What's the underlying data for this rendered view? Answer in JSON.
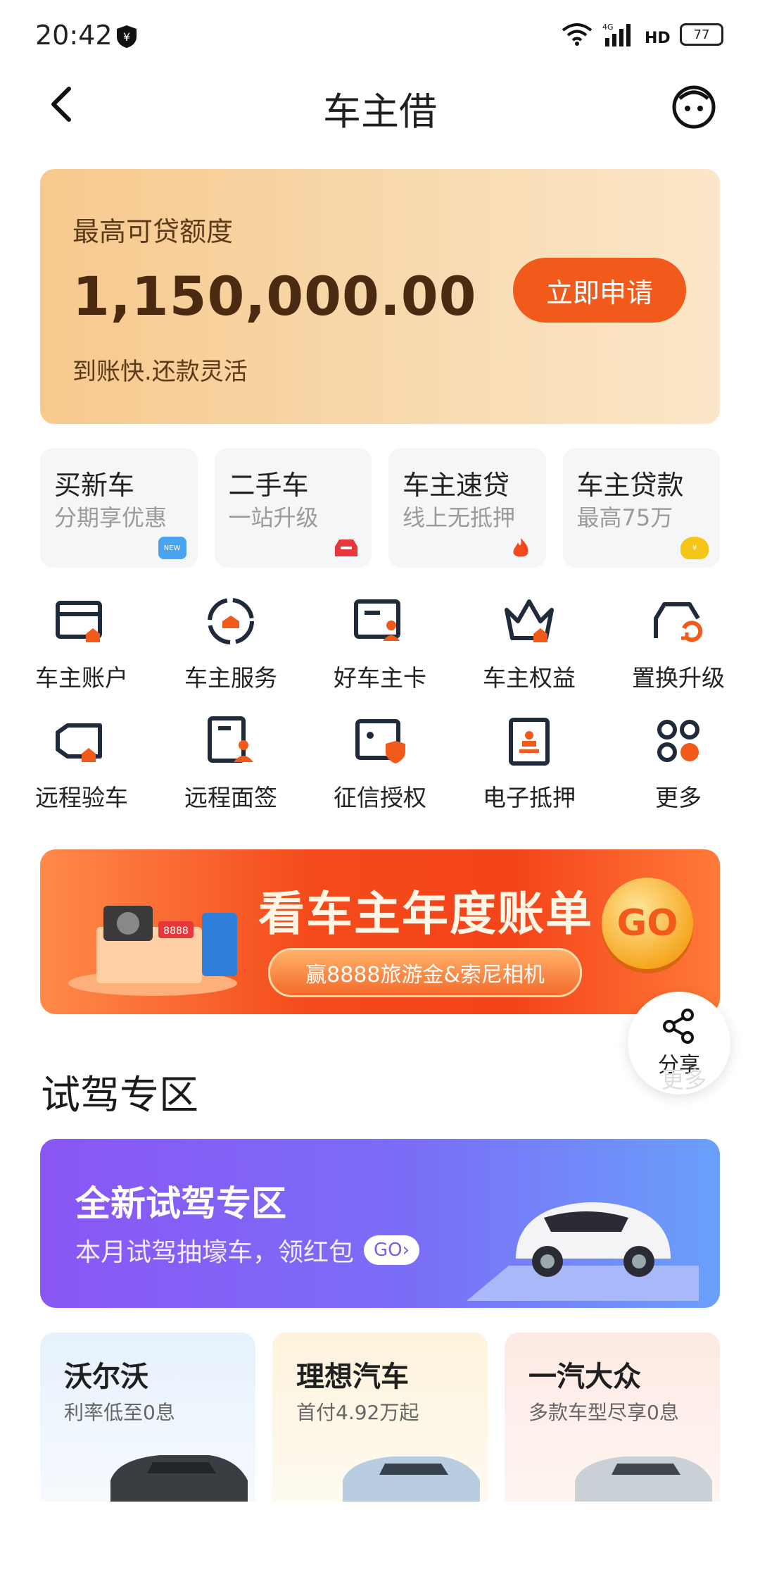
{
  "status": {
    "time": "20:42",
    "battery": "77",
    "network": "4G"
  },
  "nav": {
    "title": "车主借"
  },
  "loan": {
    "label": "最高可贷额度",
    "amount": "1,150,000.00",
    "sub": "到账快.还款灵活",
    "apply": "立即申请"
  },
  "quick": [
    {
      "title": "买新车",
      "sub": "分期享优惠",
      "badge": "NEW",
      "icon": "new-badge-icon"
    },
    {
      "title": "二手车",
      "sub": "一站升级",
      "badge": "",
      "icon": "car-badge-icon"
    },
    {
      "title": "车主速贷",
      "sub": "线上无抵押",
      "badge": "",
      "icon": "fire-icon"
    },
    {
      "title": "车主贷款",
      "sub": "最高75万",
      "badge": "¥",
      "icon": "money-bag-icon"
    }
  ],
  "grid": [
    {
      "label": "车主账户",
      "icon": "account-card-icon"
    },
    {
      "label": "车主服务",
      "icon": "service-circle-icon"
    },
    {
      "label": "好车主卡",
      "icon": "member-card-icon"
    },
    {
      "label": "车主权益",
      "icon": "crown-icon"
    },
    {
      "label": "置换升级",
      "icon": "swap-car-icon"
    },
    {
      "label": "远程验车",
      "icon": "camera-inspect-icon"
    },
    {
      "label": "远程面签",
      "icon": "remote-sign-icon"
    },
    {
      "label": "征信授权",
      "icon": "credit-auth-icon"
    },
    {
      "label": "电子抵押",
      "icon": "stamp-doc-icon"
    },
    {
      "label": "更多",
      "icon": "more-dots-icon"
    }
  ],
  "banner": {
    "title": "看车主年度账单",
    "pill": "赢8888旅游金&索尼相机",
    "go": "GO"
  },
  "share": {
    "label": "分享",
    "ghost": "更多"
  },
  "section": {
    "title": "试驾专区"
  },
  "testdrive": {
    "title": "全新试驾专区",
    "sub": "本月试驾抽壕车，领红包",
    "go": "GO"
  },
  "brands": [
    {
      "name": "沃尔沃",
      "sub": "利率低至0息",
      "bg": "#e8f2fc"
    },
    {
      "name": "理想汽车",
      "sub": "首付4.92万起",
      "bg": "#fdf4e0"
    },
    {
      "name": "一汽大众",
      "sub": "多款车型尽享0息",
      "bg": "#fdebe6"
    }
  ],
  "colors": {
    "accent": "#f25a1b",
    "icon_dark": "#1f2b3a",
    "icon_orange": "#f25a1b"
  }
}
